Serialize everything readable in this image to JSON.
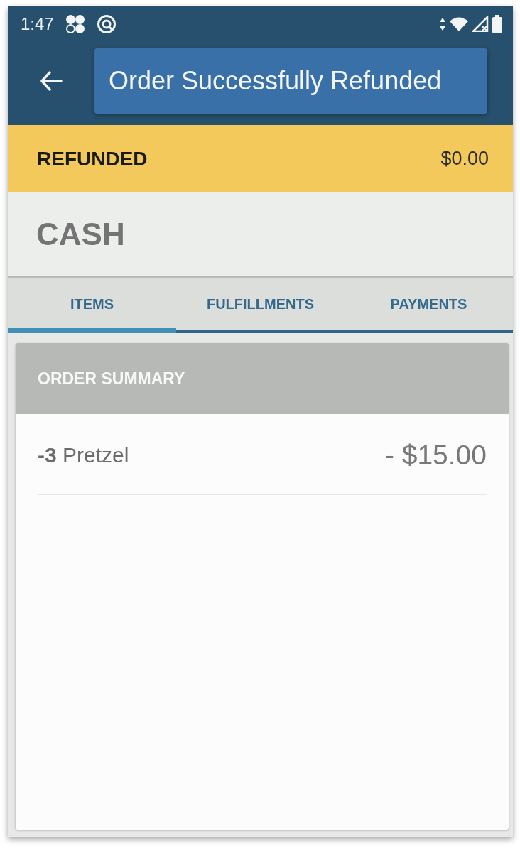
{
  "status_bar": {
    "time": "1:47"
  },
  "app_bar": {
    "toast": "Order Successfully Refunded"
  },
  "status_banner": {
    "label": "REFUNDED",
    "amount": "$0.00"
  },
  "payment_method": "CASH",
  "tabs": [
    {
      "label": "ITEMS",
      "selected": true
    },
    {
      "label": "FULFILLMENTS",
      "selected": false
    },
    {
      "label": "PAYMENTS",
      "selected": false
    }
  ],
  "order_summary": {
    "title": "ORDER SUMMARY",
    "items": [
      {
        "label": "**-3** Pretzel",
        "price": "- $15.00"
      }
    ]
  }
}
